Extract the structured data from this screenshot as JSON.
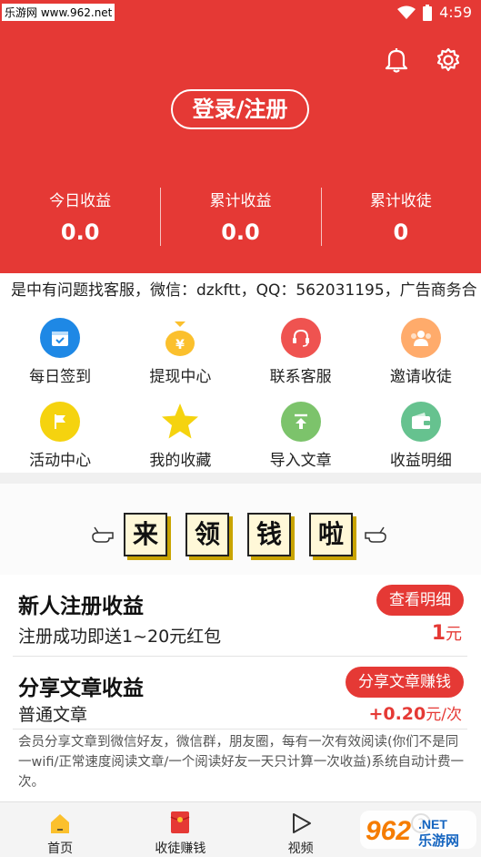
{
  "status": {
    "watermark": "乐游网 www.962.net",
    "time": "4:59"
  },
  "header": {
    "login_label": "登录/注册",
    "stats": [
      {
        "label": "今日收益",
        "value": "0.0"
      },
      {
        "label": "累计收益",
        "value": "0.0"
      },
      {
        "label": "累计收徒",
        "value": "0"
      }
    ]
  },
  "marquee": "是中有问题找客服，微信：dzkftt，QQ：562031195，广告商务合",
  "grid": [
    {
      "label": "每日签到",
      "icon": "calendar-check-icon",
      "color": "#1e88e5"
    },
    {
      "label": "提现中心",
      "icon": "money-bag-icon",
      "color": "#fbc02d"
    },
    {
      "label": "联系客服",
      "icon": "headset-icon",
      "color": "#ef5350"
    },
    {
      "label": "邀请收徒",
      "icon": "people-icon",
      "color": "#ffab6b"
    },
    {
      "label": "活动中心",
      "icon": "flag-icon",
      "color": "#f5d30f"
    },
    {
      "label": "我的收藏",
      "icon": "star-icon",
      "color": "#f5d30f"
    },
    {
      "label": "导入文章",
      "icon": "import-icon",
      "color": "#7cc36b"
    },
    {
      "label": "收益明细",
      "icon": "wallet-icon",
      "color": "#66c28f"
    }
  ],
  "banner": {
    "chars": [
      "来",
      "领",
      "钱",
      "啦"
    ]
  },
  "rewards": {
    "signup": {
      "title": "新人注册收益",
      "button": "查看明细",
      "sub": "注册成功即送1~20元红包",
      "amount": "1",
      "unit": "元"
    },
    "share": {
      "title": "分享文章收益",
      "button": "分享文章赚钱",
      "sub": "普通文章",
      "amount": "+0.20",
      "unit": "元/次",
      "desc": "会员分享文章到微信好友，微信群，朋友圈，每有一次有效阅读(你们不是同一wifi/正常速度阅读文章/一个阅读好友一天只计算一次收益)系统自动计费一次。"
    }
  },
  "bottom_nav": [
    {
      "label": "首页",
      "icon": "home-icon"
    },
    {
      "label": "收徒赚钱",
      "icon": "red-envelope-icon"
    },
    {
      "label": "视频",
      "icon": "play-icon"
    },
    {
      "label": "",
      "icon": "question-icon"
    }
  ],
  "watermark_br": "962.NET 乐游网",
  "colors": {
    "brand_red": "#e53935"
  }
}
